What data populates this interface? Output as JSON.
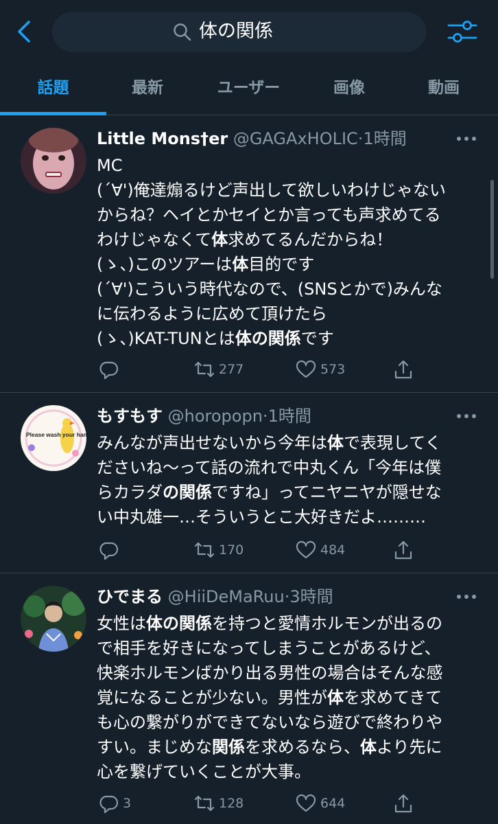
{
  "search": {
    "query": "体の関係"
  },
  "tabs": [
    {
      "label": "話題"
    },
    {
      "label": "最新"
    },
    {
      "label": "ユーザー"
    },
    {
      "label": "画像"
    },
    {
      "label": "動画"
    }
  ],
  "tweets": [
    {
      "name": "Little Mons†er",
      "handle": "@GAGAxHOLIC",
      "time": "1時間",
      "lines": [
        [
          {
            "t": "MC"
          }
        ],
        [
          {
            "t": "(´∀')俺達煽るけど声出して欲しいわけじゃない"
          }
        ],
        [
          {
            "t": "からね？ヘイとかセイとか言っても声求めてる"
          }
        ],
        [
          {
            "t": "わけじゃなくて"
          },
          {
            "t": "体",
            "b": true
          },
          {
            "t": "求めてるんだからね！"
          }
        ],
        [
          {
            "t": "(ゝ、)このツアーは"
          },
          {
            "t": "体",
            "b": true
          },
          {
            "t": "目的です"
          }
        ],
        [
          {
            "t": "(´∀')こういう時代なので、(SNSとかで)みんな"
          }
        ],
        [
          {
            "t": "に伝わるように広めて頂けたら"
          }
        ],
        [
          {
            "t": "(ゝ、)KAT-TUNとは"
          },
          {
            "t": "体の関係",
            "b": true
          },
          {
            "t": "です"
          }
        ]
      ],
      "replies": "",
      "retweets": "277",
      "likes": "573"
    },
    {
      "name": "もすもす",
      "handle": "@horopopn",
      "time": "1時間",
      "avatar_text": "Please wash your hands",
      "lines": [
        [
          {
            "t": "みんなが声出せないから今年は"
          },
          {
            "t": "体",
            "b": true
          },
          {
            "t": "で表現してく"
          }
        ],
        [
          {
            "t": "ださいね〜って話の流れで中丸くん「今年は僕"
          }
        ],
        [
          {
            "t": "らカラダ"
          },
          {
            "t": "の関係",
            "b": true
          },
          {
            "t": "ですね」ってニヤニヤが隠せな"
          }
        ],
        [
          {
            "t": "い中丸雄一…そういうとこ大好きだよ………"
          }
        ]
      ],
      "replies": "",
      "retweets": "170",
      "likes": "484"
    },
    {
      "name": "ひでまる",
      "handle": "@HiiDeMaRuu",
      "time": "3時間",
      "lines": [
        [
          {
            "t": "女性は"
          },
          {
            "t": "体の関係",
            "b": true
          },
          {
            "t": "を持つと愛情ホルモンが出るの"
          }
        ],
        [
          {
            "t": "で相手を好きになってしまうことがあるけど、"
          }
        ],
        [
          {
            "t": "快楽ホルモンばかり出る男性の場合はそんな感"
          }
        ],
        [
          {
            "t": "覚になることが少ない。男性が"
          },
          {
            "t": "体",
            "b": true
          },
          {
            "t": "を求めてきて"
          }
        ],
        [
          {
            "t": "も心の繋がりができてないなら遊びで終わりや"
          }
        ],
        [
          {
            "t": "すい。まじめな"
          },
          {
            "t": "関係",
            "b": true
          },
          {
            "t": "を求めるなら、"
          },
          {
            "t": "体",
            "b": true
          },
          {
            "t": "より先に"
          }
        ],
        [
          {
            "t": "心を繋げていくことが大事。"
          }
        ]
      ],
      "replies": "3",
      "retweets": "128",
      "likes": "644"
    }
  ],
  "colors": {
    "background": "#15202b",
    "accent": "#1da1f2",
    "secondary_text": "#8899a6",
    "divider": "#38444d"
  }
}
